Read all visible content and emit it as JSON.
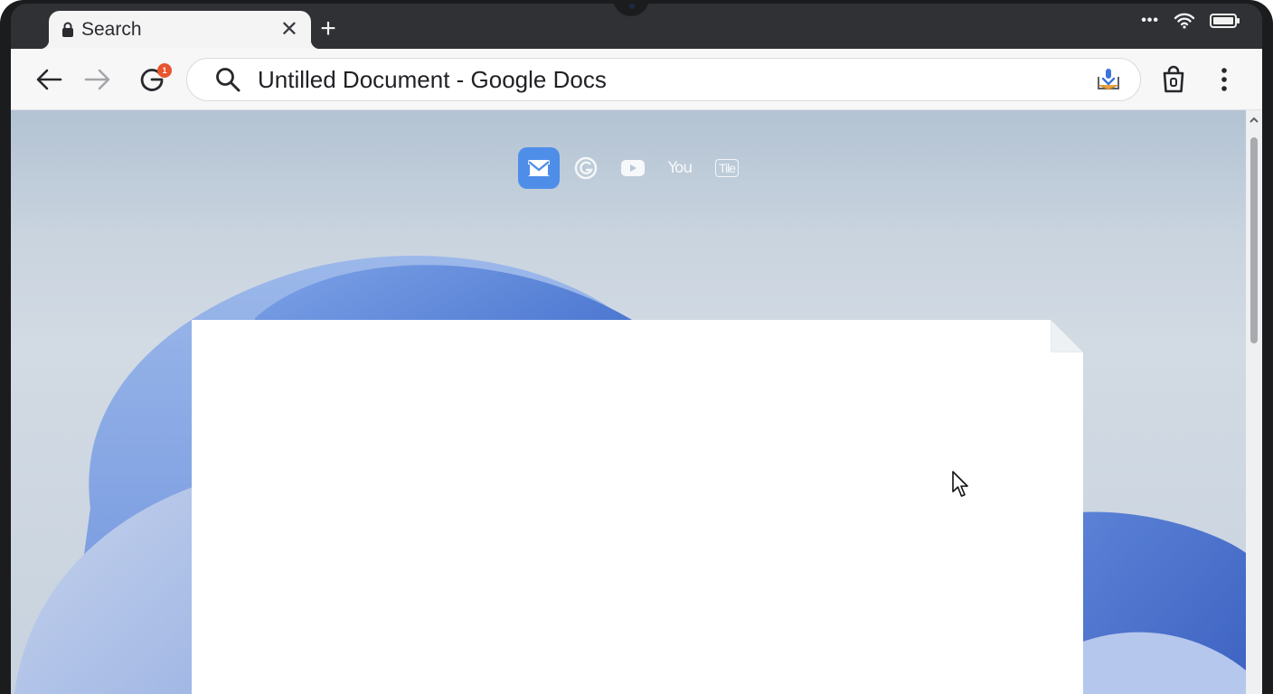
{
  "browser": {
    "tab": {
      "title": "Search",
      "icon": "lock-icon"
    },
    "new_tab_symbol": "+",
    "reload_badge": "1",
    "omnibox": {
      "text": "Untilled Document - Google Docs"
    }
  },
  "shortcuts": [
    {
      "name": "mail",
      "icon": "mail-icon"
    },
    {
      "name": "google",
      "icon": "google-g-icon"
    },
    {
      "name": "youtube",
      "icon": "youtube-play-icon"
    },
    {
      "name": "you",
      "label": "You"
    },
    {
      "name": "tile",
      "label": "Tile"
    }
  ],
  "colors": {
    "accent": "#4f8ee8",
    "badge": "#e8552e",
    "wallpaper_blue": "#4a72cf"
  }
}
